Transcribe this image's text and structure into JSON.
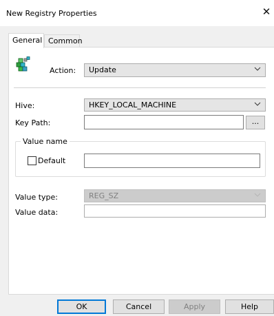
{
  "window": {
    "title": "New Registry Properties"
  },
  "tabs": [
    {
      "label": "General"
    },
    {
      "label": "Common"
    }
  ],
  "action": {
    "label": "Action:",
    "value": "Update"
  },
  "hive": {
    "label": "Hive:",
    "value": "HKEY_LOCAL_MACHINE"
  },
  "key_path": {
    "label": "Key Path:",
    "value": "",
    "browse_label": "..."
  },
  "value_name": {
    "legend": "Value name",
    "default_label": "Default",
    "default_checked": false,
    "value": ""
  },
  "value_type": {
    "label": "Value type:",
    "value": "REG_SZ"
  },
  "value_data": {
    "label": "Value data:",
    "value": ""
  },
  "buttons": {
    "ok": "OK",
    "cancel": "Cancel",
    "apply": "Apply",
    "help": "Help"
  },
  "icons": {
    "close": "close-icon",
    "app": "registry-cubes-icon",
    "chevron": "chevron-down-icon"
  }
}
